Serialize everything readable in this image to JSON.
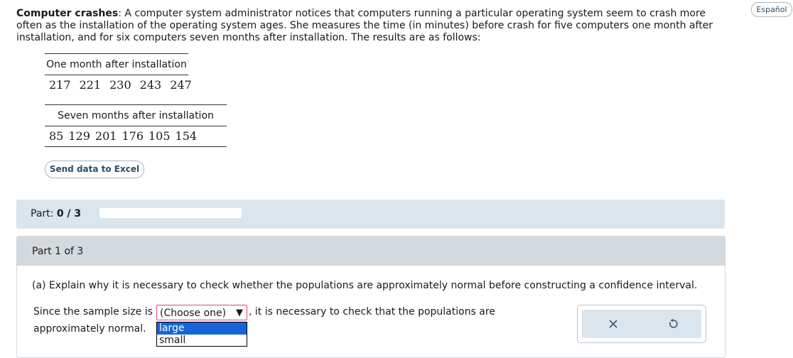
{
  "language_button": "Español",
  "problem": {
    "title": "Computer crashes",
    "body": ": A computer system administrator notices that computers running a particular operating system seem to crash more often as the installation of the operating system ages. She measures the time (in minutes) before crash for five computers one month after installation, and for six computers seven months after installation. The results are as follows:"
  },
  "table1": {
    "header": "One month after installation",
    "values": [
      "217",
      "221",
      "230",
      "243",
      "247"
    ]
  },
  "table2": {
    "header": "Seven months after installation",
    "values": [
      "85",
      "129",
      "201",
      "176",
      "105",
      "154"
    ]
  },
  "excel_button": "Send data to Excel",
  "part_bar": {
    "label": "Part:",
    "score": "0 / 3",
    "progress_fraction": 0
  },
  "part_panel": {
    "header": "Part 1 of 3"
  },
  "question": {
    "text": "(a) Explain why it is necessary to check whether the populations are approximately normal before constructing a confidence interval.",
    "sentence_start": "Since the sample size is",
    "select_value": "(Choose one)",
    "select_arrow": "▼",
    "sentence_mid": ", it is necessary to check that the populations are",
    "sentence_end": "approximately normal.",
    "options": [
      "large",
      "small"
    ]
  },
  "tools": {
    "clear_icon": "close-icon",
    "reset_icon": "undo-icon"
  },
  "colors": {
    "accent": "#2b4d66",
    "panel_bg": "#dbe5ed",
    "header_bg": "#d3d9dd",
    "select_border": "#d94b6b",
    "option_selected": "#1565d6"
  }
}
